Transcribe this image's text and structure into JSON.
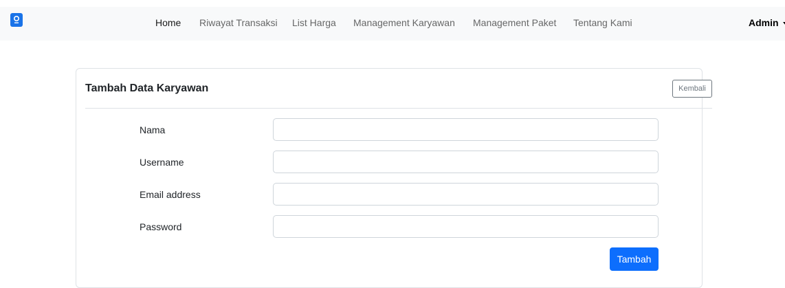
{
  "navbar": {
    "logo": "logo-icon",
    "links": [
      {
        "label": "Home",
        "active": true
      },
      {
        "label": "Riwayat Transaksi"
      },
      {
        "label": "List Harga"
      },
      {
        "label": "Management Karyawan"
      },
      {
        "label": "Management Paket"
      },
      {
        "label": "Tentang Kami"
      }
    ],
    "user": "Admin"
  },
  "form": {
    "title": "Tambah Data Karyawan",
    "back_label": "Kembali",
    "fields": [
      {
        "label": "Nama",
        "value": "",
        "placeholder": ""
      },
      {
        "label": "Username",
        "value": "",
        "placeholder": ""
      },
      {
        "label": "Email address",
        "value": "",
        "placeholder": ""
      },
      {
        "label": "Password",
        "value": "",
        "placeholder": ""
      }
    ],
    "submit_label": "Tambah"
  },
  "colors": {
    "primary": "#0d6efd",
    "navbar_bg": "#f8f9fa",
    "logo_bg": "#1a73e8"
  }
}
